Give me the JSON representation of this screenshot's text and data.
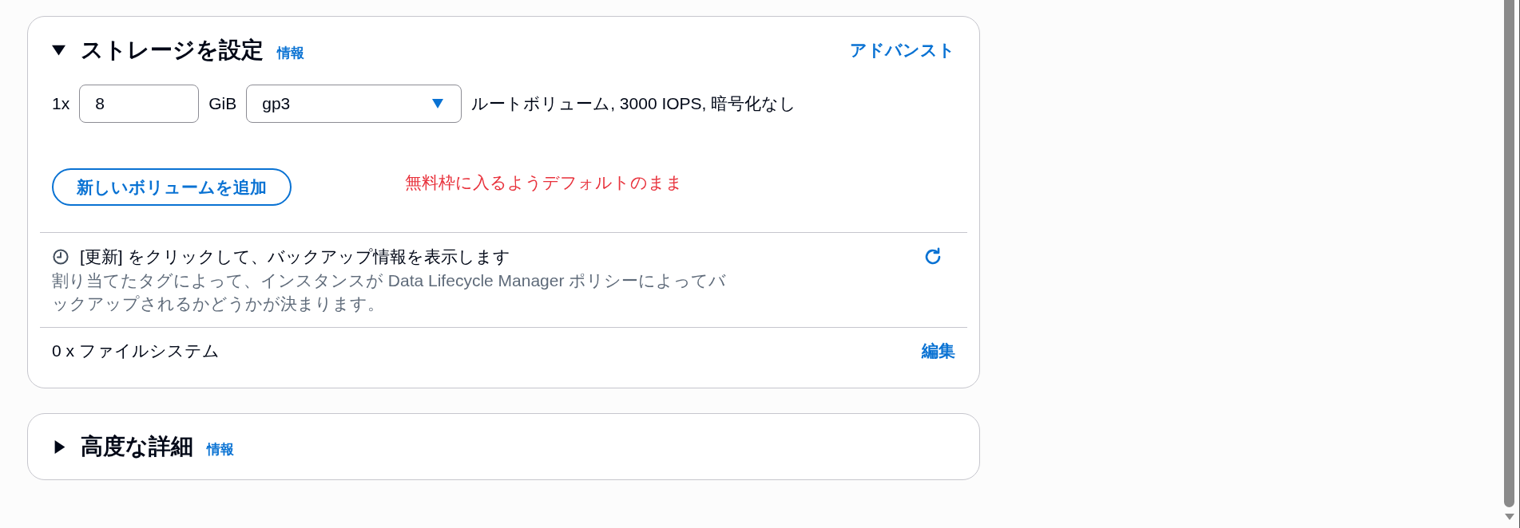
{
  "storage_panel": {
    "expanded": true,
    "title": "ストレージを設定",
    "info_link": "情報",
    "advanced_link": "アドバンスト",
    "volumes": [
      {
        "count": "1x",
        "size": "8",
        "unit": "GiB",
        "volume_type": "gp3",
        "description": "ルートボリューム, 3000 IOPS, 暗号化なし"
      }
    ],
    "add_volume_button": "新しいボリュームを追加",
    "annotation": "無料枠に入るようデフォルトのまま",
    "backup": {
      "message": "[更新] をクリックして、バックアップ情報を表示します",
      "description": "割り当てたタグによって、インスタンスが Data Lifecycle Manager ポリシーによってバックアップされるかどうかが決まります。"
    },
    "file_systems": {
      "label": "0 x ファイルシステム",
      "edit_link": "編集"
    }
  },
  "advanced_panel": {
    "expanded": false,
    "title": "高度な詳細",
    "info_link": "情報"
  }
}
